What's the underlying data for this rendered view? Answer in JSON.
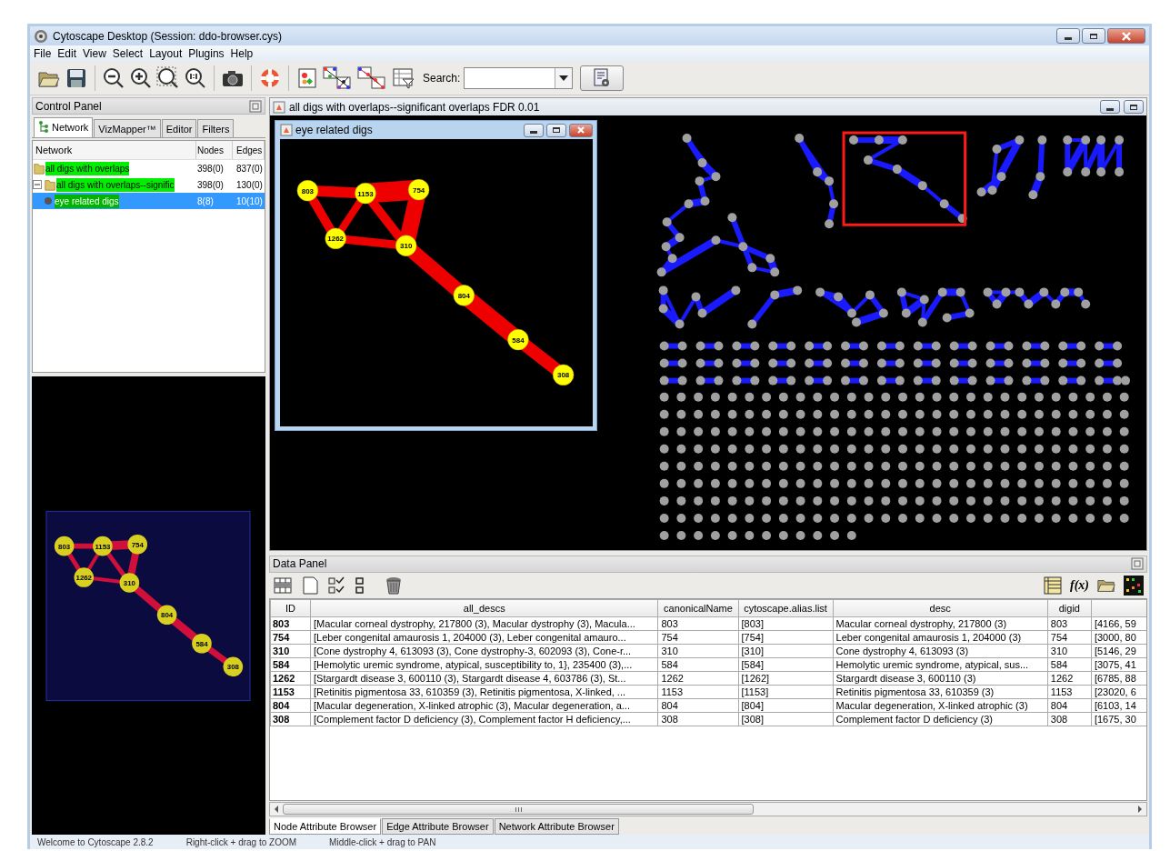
{
  "window": {
    "title": "Cytoscape Desktop (Session: ddo-browser.cys)"
  },
  "menu": [
    "File",
    "Edit",
    "View",
    "Select",
    "Layout",
    "Plugins",
    "Help"
  ],
  "toolbar": {
    "search_label": "Search:"
  },
  "control_panel": {
    "title": "Control Panel",
    "tabs": [
      {
        "label": "Network",
        "selected": true
      },
      {
        "label": "VizMapper™",
        "selected": false
      },
      {
        "label": "Editor",
        "selected": false
      },
      {
        "label": "Filters",
        "selected": false
      }
    ],
    "columns": [
      "Network",
      "Nodes",
      "Edges"
    ],
    "tree": [
      {
        "name": "all digs with overlaps",
        "nodes": "398(0)",
        "edges": "837(0)",
        "selected": false
      },
      {
        "name": "all digs with overlaps--signific",
        "nodes": "398(0)",
        "edges": "130(0)",
        "selected": false,
        "expanded": true,
        "children": [
          {
            "name": "eye related digs",
            "nodes": "8(8)",
            "edges": "10(10)",
            "selected": true
          }
        ]
      }
    ]
  },
  "overview": {
    "nodes": [
      "803",
      "1153",
      "754",
      "1262",
      "310",
      "804",
      "584",
      "308"
    ]
  },
  "network_view": {
    "title": "all digs with overlaps--significant overlaps FDR 0.01"
  },
  "subwindow": {
    "title": "eye related digs",
    "nodes": [
      "803",
      "1153",
      "754",
      "1262",
      "310",
      "804",
      "584",
      "308"
    ]
  },
  "data_panel": {
    "title": "Data Panel",
    "function_label": "f(x)",
    "columns": [
      "ID",
      "all_descs",
      "canonicalName",
      "cytoscape.alias.list",
      "desc",
      "digid"
    ],
    "rows": [
      [
        "803",
        "[Macular corneal dystrophy, 217800 (3), Macular dystrophy (3), Macula...",
        "803",
        "[803]",
        "Macular corneal dystrophy, 217800 (3)",
        "803",
        "[4166, 59"
      ],
      [
        "754",
        "[Leber congenital amaurosis 1, 204000 (3), Leber congenital amauro...",
        "754",
        "[754]",
        "Leber congenital amaurosis 1, 204000 (3)",
        "754",
        "[3000, 80"
      ],
      [
        "310",
        "[Cone dystrophy 4, 613093 (3), Cone dystrophy-3, 602093 (3), Cone-r...",
        "310",
        "[310]",
        "Cone dystrophy 4, 613093 (3)",
        "310",
        "[5146, 29"
      ],
      [
        "584",
        "[Hemolytic uremic syndrome, atypical, susceptibility to, 1}, 235400 (3),...",
        "584",
        "[584]",
        "Hemolytic uremic syndrome, atypical, sus...",
        "584",
        "[3075, 41"
      ],
      [
        "1262",
        "[Stargardt disease 3, 600110 (3), Stargardt disease 4, 603786 (3), St...",
        "1262",
        "[1262]",
        "Stargardt disease 3, 600110 (3)",
        "1262",
        "[6785, 88"
      ],
      [
        "1153",
        "[Retinitis pigmentosa 33, 610359 (3), Retinitis pigmentosa, X-linked, ...",
        "1153",
        "[1153]",
        "Retinitis pigmentosa 33, 610359 (3)",
        "1153",
        "[23020, 6"
      ],
      [
        "804",
        "[Macular degeneration, X-linked atrophic (3), Macular degeneration, a...",
        "804",
        "[804]",
        "Macular degeneration, X-linked atrophic (3)",
        "804",
        "[6103, 14"
      ],
      [
        "308",
        "[Complement factor D deficiency (3), Complement factor H deficiency,...",
        "308",
        "[308]",
        "Complement factor D deficiency (3)",
        "308",
        "[1675, 30"
      ]
    ],
    "tabs": [
      {
        "label": "Node Attribute Browser",
        "selected": true
      },
      {
        "label": "Edge Attribute Browser",
        "selected": false
      },
      {
        "label": "Network Attribute Browser",
        "selected": false
      }
    ]
  },
  "status_bar": [
    "Welcome to Cytoscape 2.8.2",
    "Right-click + drag to ZOOM",
    "Middle-click + drag to PAN"
  ]
}
